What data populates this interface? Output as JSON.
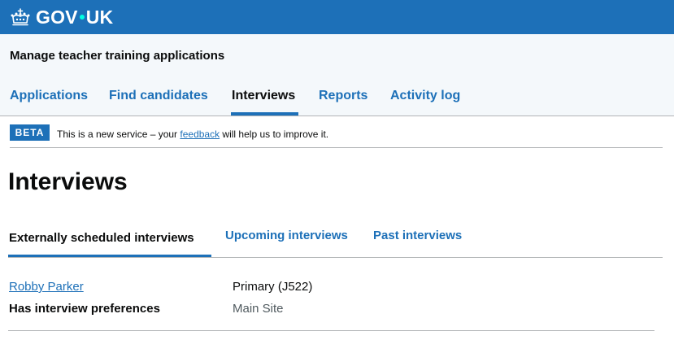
{
  "header": {
    "logo_text_left": "GOV",
    "logo_text_right": "UK"
  },
  "service": {
    "name": "Manage teacher training applications"
  },
  "nav": {
    "items": [
      {
        "label": "Applications"
      },
      {
        "label": "Find candidates"
      },
      {
        "label": "Interviews"
      },
      {
        "label": "Reports"
      },
      {
        "label": "Activity log"
      }
    ],
    "active": "Interviews"
  },
  "beta": {
    "tag": "BETA",
    "text_before": "This is a new service – your ",
    "link": "feedback",
    "text_after": " will help us to improve it."
  },
  "page": {
    "title": "Interviews"
  },
  "subtabs": {
    "items": [
      {
        "label": "Externally scheduled interviews"
      },
      {
        "label": "Upcoming interviews"
      },
      {
        "label": "Past interviews"
      }
    ],
    "active": "Externally scheduled interviews"
  },
  "interviews": [
    {
      "candidate": "Robby Parker",
      "status": "Has interview preferences",
      "course": "Primary (J522)",
      "site": "Main Site"
    }
  ],
  "colors": {
    "brand_blue": "#1d70b8",
    "text": "#0b0c0c",
    "secondary_text": "#505a5f",
    "border": "#b1b4b6"
  }
}
